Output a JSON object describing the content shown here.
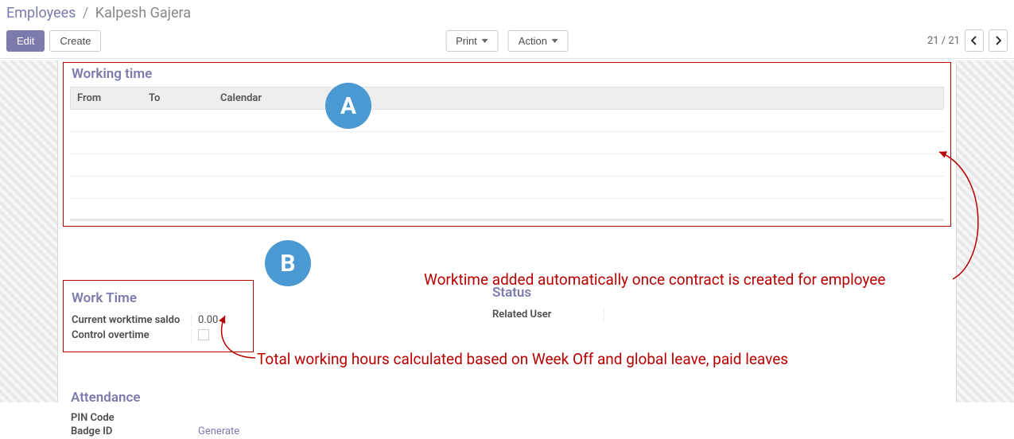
{
  "breadcrumb": {
    "parent": "Employees",
    "current": "Kalpesh Gajera"
  },
  "buttons": {
    "edit": "Edit",
    "create": "Create",
    "print": "Print",
    "action": "Action"
  },
  "pager": {
    "text": "21 / 21"
  },
  "sections": {
    "working_time": {
      "title": "Working time",
      "cols": {
        "from": "From",
        "to": "To",
        "calendar": "Calendar"
      }
    },
    "work_time": {
      "title": "Work Time",
      "saldo_label": "Current worktime saldo",
      "saldo_value": "0.00",
      "overtime_label": "Control overtime"
    },
    "status": {
      "title": "Status",
      "related_user_label": "Related User",
      "related_user_value": ""
    },
    "attendance": {
      "title": "Attendance",
      "pin_label": "PIN Code",
      "pin_value": "",
      "badge_label": "Badge ID",
      "badge_action": "Generate"
    }
  },
  "annotations": {
    "a": "A",
    "b": "B",
    "note1": "Worktime added automatically once contract is created for employee",
    "note2": "Total working hours calculated based on Week Off and global leave, paid leaves"
  }
}
